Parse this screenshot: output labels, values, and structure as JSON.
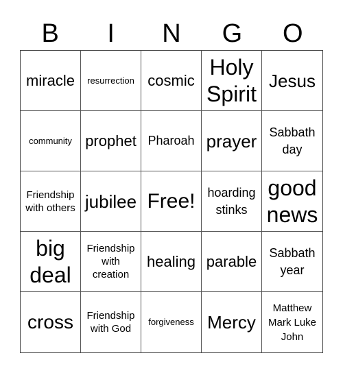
{
  "header": {
    "letters": [
      "B",
      "I",
      "N",
      "G",
      "O"
    ]
  },
  "grid": {
    "cells": [
      "miracle",
      "resurrection",
      "cosmic",
      "Holy Spirit",
      "Jesus",
      "community",
      "prophet",
      "Pharoah",
      "prayer",
      "Sabbath day",
      "Friendship with others",
      "jubilee",
      "Free!",
      "hoarding stinks",
      "good news",
      "big deal",
      "Friendship with creation",
      "healing",
      "parable",
      "Sabbath year",
      "cross",
      "Friendship with God",
      "forgiveness",
      "Mercy",
      "Matthew Mark Luke John"
    ],
    "free_space": "Free!"
  }
}
